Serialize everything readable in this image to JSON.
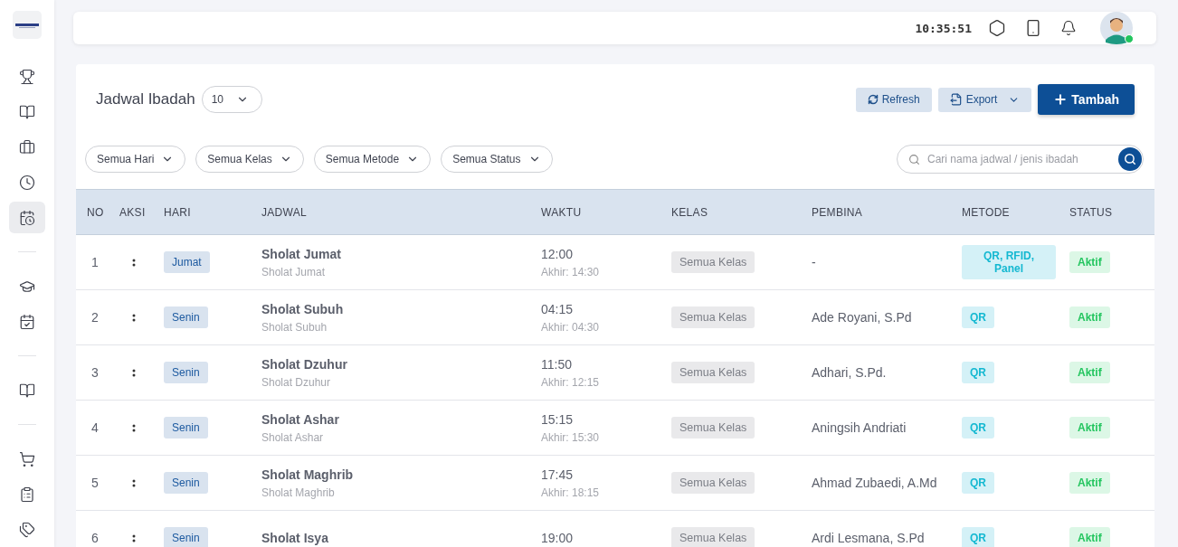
{
  "sidebar": {
    "groups": [
      [
        {
          "selected": false
        },
        {
          "selected": false
        },
        {
          "selected": false
        },
        {
          "selected": false
        },
        {
          "selected": true
        }
      ],
      [
        {
          "selected": false
        },
        {
          "selected": false
        }
      ],
      [
        {
          "selected": false
        }
      ],
      [
        {
          "selected": false
        },
        {
          "selected": false
        },
        {
          "selected": false
        }
      ]
    ]
  },
  "header": {
    "time": "10:35:51",
    "user_online": true
  },
  "page": {
    "title": "Jadwal Ibadah",
    "page_size": "10",
    "buttons": [
      {
        "kind": "refresh",
        "label": "Refresh"
      },
      {
        "kind": "export",
        "label": "Export"
      },
      {
        "kind": "add",
        "label": "Tambah"
      }
    ],
    "filters": [
      "Semua Hari",
      "Semua Kelas",
      "Semua Metode",
      "Semua Status"
    ],
    "search": {
      "placeholder": "Cari nama jadwal / jenis ibadah"
    }
  },
  "table": {
    "columns": [
      "NO",
      "AKSI",
      "HARI",
      "JADWAL",
      "WAKTU",
      "KELAS",
      "PEMBINA",
      "METODE",
      "STATUS"
    ],
    "rows": [
      {
        "no": "1",
        "hari": "Jumat",
        "jadwal": "Sholat Jumat",
        "jenis": "Sholat Jumat",
        "waktu": "12:00",
        "akhir": "Akhir: 14:30",
        "kelas": "Semua Kelas",
        "pembina": "-",
        "metode": "QR, RFID, Panel",
        "status": "Aktif"
      },
      {
        "no": "2",
        "hari": "Senin",
        "jadwal": "Sholat Subuh",
        "jenis": "Sholat Subuh",
        "waktu": "04:15",
        "akhir": "Akhir: 04:30",
        "kelas": "Semua Kelas",
        "pembina": "Ade Royani, S.Pd",
        "metode": "QR",
        "status": "Aktif"
      },
      {
        "no": "3",
        "hari": "Senin",
        "jadwal": "Sholat Dzuhur",
        "jenis": "Sholat Dzuhur",
        "waktu": "11:50",
        "akhir": "Akhir: 12:15",
        "kelas": "Semua Kelas",
        "pembina": "Adhari, S.Pd.",
        "metode": "QR",
        "status": "Aktif"
      },
      {
        "no": "4",
        "hari": "Senin",
        "jadwal": "Sholat Ashar",
        "jenis": "Sholat Ashar",
        "waktu": "15:15",
        "akhir": "Akhir: 15:30",
        "kelas": "Semua Kelas",
        "pembina": "Aningsih Andriati",
        "metode": "QR",
        "status": "Aktif"
      },
      {
        "no": "5",
        "hari": "Senin",
        "jadwal": "Sholat Maghrib",
        "jenis": "Sholat Maghrib",
        "waktu": "17:45",
        "akhir": "Akhir: 18:15",
        "kelas": "Semua Kelas",
        "pembina": "Ahmad Zubaedi, A.Md",
        "metode": "QR",
        "status": "Aktif"
      },
      {
        "no": "6",
        "hari": "Senin",
        "jadwal": "Sholat Isya",
        "waktu": "19:00",
        "kelas": "Semua Kelas",
        "pembina": "Ardi Lesmana, S.Pd",
        "metode": "QR",
        "status": "Aktif"
      }
    ]
  }
}
